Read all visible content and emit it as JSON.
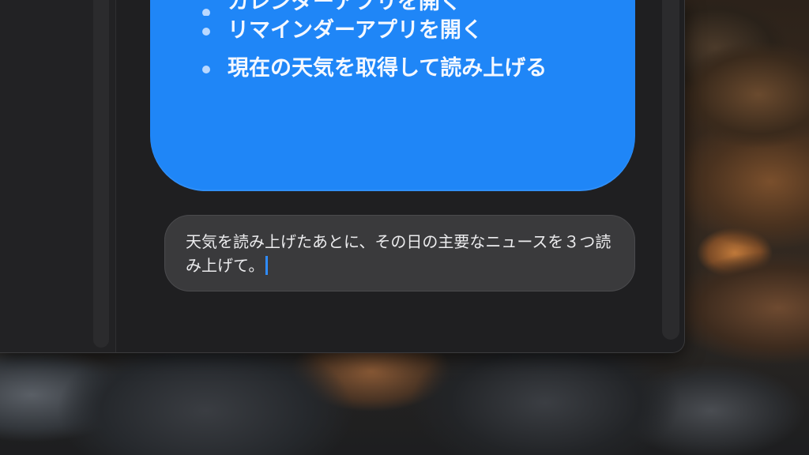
{
  "response": {
    "items": [
      "カレンダーアプリを開く",
      "リマインダーアプリを開く",
      "現在の天気を取得して読み上げる"
    ]
  },
  "input": {
    "value": "天気を読み上げたあとに、その日の主要なニュースを３つ読み上げて。"
  },
  "colors": {
    "bubble": "#1F86F7",
    "caret": "#2F8CFF"
  }
}
